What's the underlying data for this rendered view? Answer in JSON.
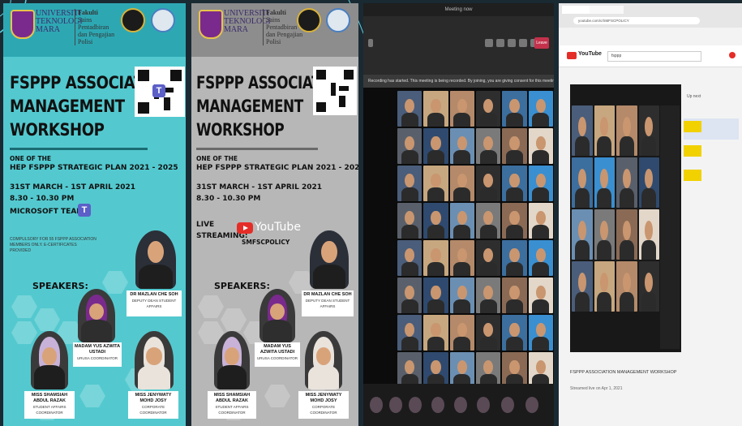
{
  "posters": [
    {
      "university": [
        "UNIVERSITI",
        "TEKNOLOGI",
        "MARA"
      ],
      "faculty": [
        "Fakulti",
        "Sains Pentadbiran",
        "dan Pengajian",
        "Polisi"
      ],
      "title": [
        "FSPPP ASSOCIATION",
        "MANAGEMENT",
        "WORKSHOP"
      ],
      "one_of_the": "ONE OF THE",
      "plan": "HEP FSPPP STRATEGIC PLAN 2021 - 2025",
      "dates": "31ST MARCH - 1ST APRIL 2021",
      "time": "8.30 - 10.30 PM",
      "platform": "MICROSOFT TEAM",
      "note": "COMPULSORY FOR 55 FSPPP ASSOCIATION MEMBERS ONLY. E-CERTIFICATES PROVIDED",
      "speakers_heading": "SPEAKERS:"
    },
    {
      "university": [
        "UNIVERSITI",
        "TEKNOLOGI",
        "MARA"
      ],
      "faculty": [
        "Fakulti",
        "Sains Pentadbiran",
        "dan Pengajian",
        "Polisi"
      ],
      "title": [
        "FSPPP ASSOCIATION",
        "MANAGEMENT",
        "WORKSHOP"
      ],
      "one_of_the": "ONE OF THE",
      "plan": "HEP FSPPP STRATEGIC PLAN 2021 - 2025",
      "dates": "31ST MARCH - 1ST APRIL 2021",
      "time": "8.30 - 10.30 PM",
      "live_label": "LIVE",
      "streaming_label": "STREAMING:",
      "youtube": "YouTube",
      "channel": "SMFSCPOLICY",
      "speakers_heading": "SPEAKERS:"
    }
  ],
  "speakers": [
    {
      "name": "DR MAZLAN CHE SOH",
      "role": "DEPUTY DEAN STUDENT AFFAIRS"
    },
    {
      "name": "MADAM YUS AZWITA USTADI",
      "role": "URUSA COORDINATOR"
    },
    {
      "name": "MISS SHAMSIAH ABDUL RAZAK",
      "role": "STUDENT AFFAIRS COORDINATOR"
    },
    {
      "name": "MISS JENYWATY MOHD JOSY",
      "role": "CORPORATE COORDINATOR"
    }
  ],
  "teams": {
    "window_title": "Meeting now",
    "leave": "Leave",
    "notice": "Recording has started. This meeting is being recorded. By joining, you are giving consent for this meeting to be recorded. Privacy policy"
  },
  "browser": {
    "address": "youtube.com/c/SMFSCPOLICY",
    "yt_word": "YouTube",
    "search_value": "fsppp",
    "up_next": "Up next",
    "video_title": "FSPPP ASSOCIATION MANAGEMENT WORKSHOP",
    "video_meta": "Streamed live on Apr 1, 2021"
  }
}
